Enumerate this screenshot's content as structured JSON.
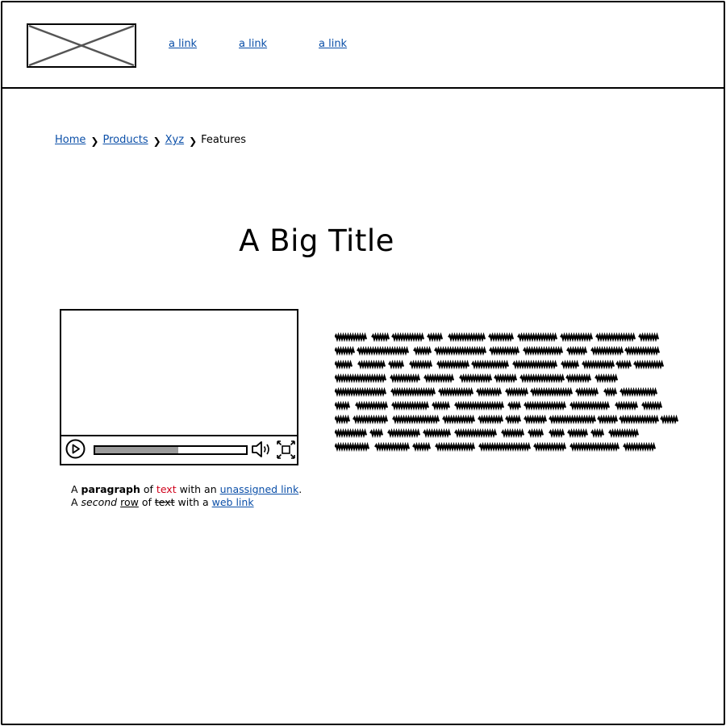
{
  "header": {
    "logo_icon": "image-placeholder-icon",
    "nav_links": [
      "a link",
      "a link",
      "a link"
    ]
  },
  "breadcrumb": {
    "items": [
      "Home",
      "Products",
      "Xyz"
    ],
    "current": "Features",
    "separator_icon": "chevron-right-icon",
    "separator": "❯"
  },
  "main": {
    "title": "A Big Title"
  },
  "video_player": {
    "progress_fraction": 0.55,
    "play_icon": "play-icon",
    "volume_icon": "volume-icon",
    "fullscreen_icon": "fullscreen-icon"
  },
  "paragraph": {
    "line1": {
      "t1": "A ",
      "bold": "paragraph",
      "t2": " of ",
      "red": "text",
      "t3": " with an ",
      "link": "unassigned link",
      "t4": "."
    },
    "line2": {
      "t1": "A ",
      "italic": "second",
      "t2": " ",
      "underlined": "row",
      "t3": " of ",
      "strike": "text",
      "t4": " with a ",
      "link": "web link"
    }
  },
  "text_block": {
    "icon": "scribbled-text-placeholder",
    "line_count": 9
  },
  "colors": {
    "link": "#0b4fa8",
    "red_text": "#d0021b",
    "progress_fill": "#9b9b9b"
  }
}
